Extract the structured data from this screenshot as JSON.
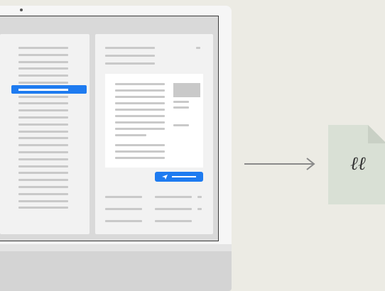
{
  "illustration": {
    "laptop": {
      "screen": {
        "left_pane": {
          "row_count": 24,
          "selected_row_index": 6
        },
        "right_pane": {
          "send_button": {
            "icon": "send-icon"
          }
        }
      }
    },
    "arrow": {
      "icon": "arrow-right-icon"
    },
    "output_file": {
      "icon": "file-icon",
      "glyph": "ℓℓ",
      "colors": {
        "fill": "#d9e0d5",
        "fold": "#c9d0c5"
      }
    }
  },
  "colors": {
    "accent": "#1e7bf0",
    "background": "#ecebe4",
    "placeholder_line": "#c9c9c9"
  }
}
